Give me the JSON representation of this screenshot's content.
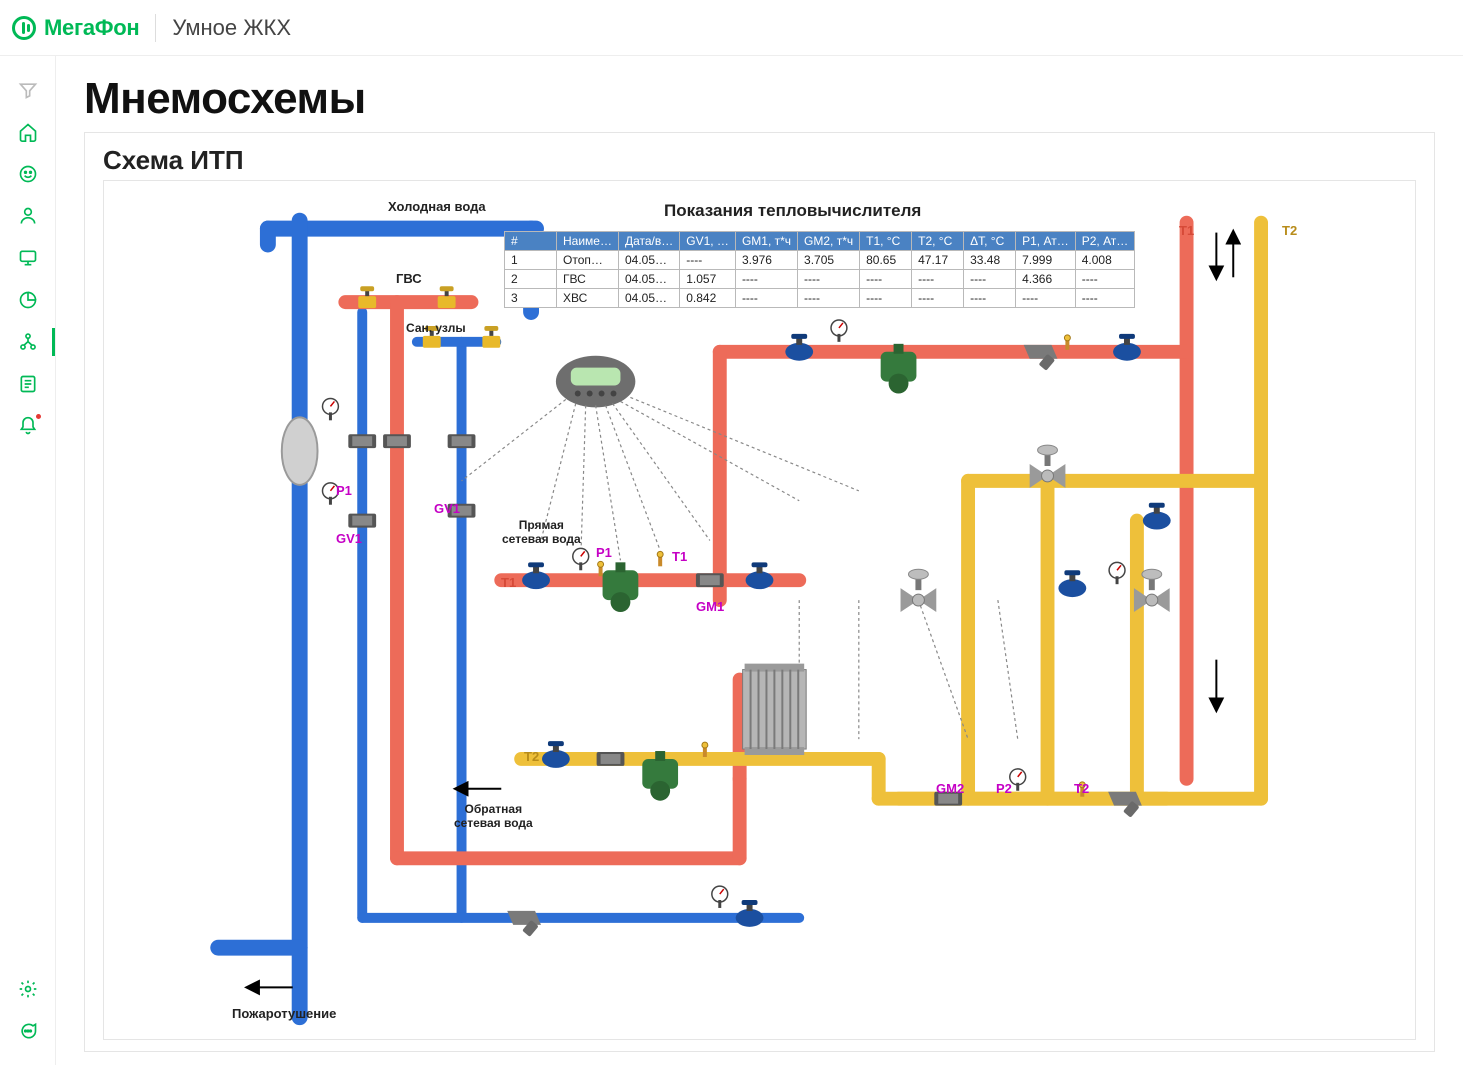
{
  "brand": "МегаФон",
  "app_name": "Умное ЖКХ",
  "page_title": "Мнемосхемы",
  "scheme_title": "Схема ИТП",
  "labels": {
    "cold_water": "Холодная вода",
    "gvs": "ГВС",
    "san_nodes": "Сан. узлы",
    "direct_net_water": "Прямая\nсетевая вода",
    "return_net_water": "Обратная\nсетевая вода",
    "fire": "Пожаротушение",
    "heat_table_title": "Показания тепловычислителя",
    "T1": "T1",
    "T2": "T2",
    "P1": "P1",
    "GV1": "GV1",
    "GM1": "GM1",
    "GM2": "GM2",
    "P2": "P2"
  },
  "heat_table": {
    "columns": [
      "#",
      "Наиме…",
      "Дата/в…",
      "GV1, …",
      "GM1, т*ч",
      "GM2, т*ч",
      "T1, °C",
      "T2, °C",
      "ΔT, °C",
      "P1, Ат…",
      "P2, Ат…"
    ],
    "rows": [
      [
        "1",
        "Отоп…",
        "04.05…",
        "----",
        "3.976",
        "3.705",
        "80.65",
        "47.17",
        "33.48",
        "7.999",
        "4.008"
      ],
      [
        "2",
        "ГВС",
        "04.05…",
        "1.057",
        "----",
        "----",
        "----",
        "----",
        "----",
        "4.366",
        "----"
      ],
      [
        "3",
        "ХВС",
        "04.05…",
        "0.842",
        "----",
        "----",
        "----",
        "----",
        "----",
        "----",
        "----"
      ]
    ]
  },
  "sidebar": {
    "items": [
      {
        "name": "filter",
        "active": false,
        "grey": true
      },
      {
        "name": "home",
        "active": false
      },
      {
        "name": "smile",
        "active": false
      },
      {
        "name": "user",
        "active": false
      },
      {
        "name": "monitor",
        "active": false
      },
      {
        "name": "pie",
        "active": false
      },
      {
        "name": "tree",
        "active": true
      },
      {
        "name": "list",
        "active": false
      },
      {
        "name": "bell",
        "active": false,
        "badge": true
      }
    ],
    "bottom": [
      {
        "name": "gear"
      },
      {
        "name": "chat"
      }
    ]
  }
}
